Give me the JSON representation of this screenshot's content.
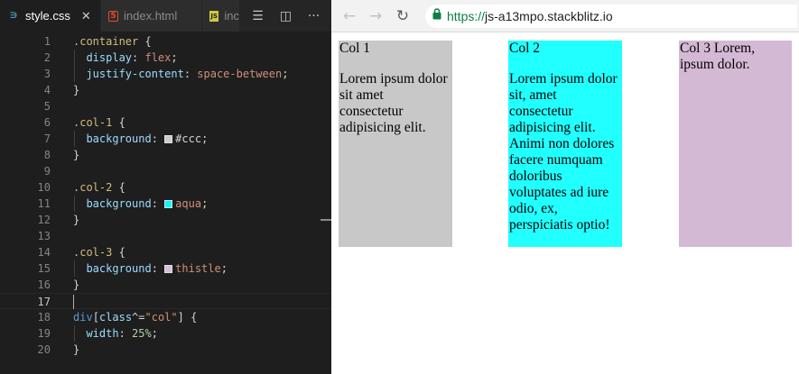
{
  "editor": {
    "tabs": [
      {
        "label": "style.css",
        "icon": "css-file-icon",
        "active": true,
        "close": "✕"
      },
      {
        "label": "index.html",
        "icon": "html-file-icon",
        "active": false
      },
      {
        "label": "inc",
        "icon": "js-file-icon",
        "active": false
      }
    ],
    "tab_icons": {
      "css": "∋",
      "html": "5",
      "js": "JS"
    },
    "actions": [
      {
        "name": "outline-icon",
        "glyph": "☰"
      },
      {
        "name": "split-editor-icon",
        "glyph": "◫"
      },
      {
        "name": "more-actions-icon",
        "glyph": "···"
      }
    ],
    "lines": [
      {
        "n": "1",
        "tokens": [
          {
            "t": ".container",
            "c": "sel"
          },
          {
            "t": " {",
            "c": "punc"
          }
        ]
      },
      {
        "n": "2",
        "indent": true,
        "tokens": [
          {
            "t": "  display",
            "c": "prop"
          },
          {
            "t": ": ",
            "c": "punc"
          },
          {
            "t": "flex",
            "c": "val"
          },
          {
            "t": ";",
            "c": "punc"
          }
        ]
      },
      {
        "n": "3",
        "indent": true,
        "tokens": [
          {
            "t": "  justify-content",
            "c": "prop"
          },
          {
            "t": ": ",
            "c": "punc"
          },
          {
            "t": "space-between",
            "c": "val"
          },
          {
            "t": ";",
            "c": "punc"
          }
        ]
      },
      {
        "n": "4",
        "tokens": [
          {
            "t": "}",
            "c": "punc"
          }
        ]
      },
      {
        "n": "5",
        "tokens": []
      },
      {
        "n": "6",
        "tokens": [
          {
            "t": ".col-1",
            "c": "sel"
          },
          {
            "t": " {",
            "c": "punc"
          }
        ]
      },
      {
        "n": "7",
        "indent": true,
        "tokens": [
          {
            "t": "  background",
            "c": "prop"
          },
          {
            "t": ": ",
            "c": "punc"
          },
          {
            "swatch": "#cccccc"
          },
          {
            "t": "#ccc",
            "c": "punc"
          },
          {
            "t": ";",
            "c": "punc"
          }
        ]
      },
      {
        "n": "8",
        "tokens": [
          {
            "t": "}",
            "c": "punc"
          }
        ]
      },
      {
        "n": "9",
        "tokens": []
      },
      {
        "n": "10",
        "tokens": [
          {
            "t": ".col-2",
            "c": "sel"
          },
          {
            "t": " {",
            "c": "punc"
          }
        ]
      },
      {
        "n": "11",
        "indent": true,
        "tokens": [
          {
            "t": "  background",
            "c": "prop"
          },
          {
            "t": ": ",
            "c": "punc"
          },
          {
            "swatch": "#00ffff"
          },
          {
            "t": "aqua",
            "c": "val"
          },
          {
            "t": ";",
            "c": "punc"
          }
        ]
      },
      {
        "n": "12",
        "tokens": [
          {
            "t": "}",
            "c": "punc"
          }
        ]
      },
      {
        "n": "13",
        "tokens": []
      },
      {
        "n": "14",
        "tokens": [
          {
            "t": ".col-3",
            "c": "sel"
          },
          {
            "t": " {",
            "c": "punc"
          }
        ]
      },
      {
        "n": "15",
        "indent": true,
        "tokens": [
          {
            "t": "  background",
            "c": "prop"
          },
          {
            "t": ": ",
            "c": "punc"
          },
          {
            "swatch": "#d8bfd8"
          },
          {
            "t": "thistle",
            "c": "val"
          },
          {
            "t": ";",
            "c": "punc"
          }
        ]
      },
      {
        "n": "16",
        "tokens": [
          {
            "t": "}",
            "c": "punc"
          }
        ]
      },
      {
        "n": "17",
        "current": true,
        "tokens": []
      },
      {
        "n": "18",
        "tokens": [
          {
            "t": "div",
            "c": "tagc"
          },
          {
            "t": "[",
            "c": "punc"
          },
          {
            "t": "class",
            "c": "prop"
          },
          {
            "t": "^=",
            "c": "punc"
          },
          {
            "t": "\"col\"",
            "c": "val"
          },
          {
            "t": "] {",
            "c": "punc"
          }
        ]
      },
      {
        "n": "19",
        "indent": true,
        "tokens": [
          {
            "t": "  width",
            "c": "prop"
          },
          {
            "t": ": ",
            "c": "punc"
          },
          {
            "t": "25%",
            "c": "num"
          },
          {
            "t": ";",
            "c": "punc"
          }
        ]
      },
      {
        "n": "20",
        "tokens": [
          {
            "t": "}",
            "c": "punc"
          }
        ]
      }
    ]
  },
  "browser": {
    "nav": {
      "back": "←",
      "forward": "→",
      "reload": "↻"
    },
    "url_scheme": "https://",
    "url_host": "js-a13mpo.stackblitz.io",
    "columns": [
      {
        "heading": "Col 1",
        "body": "Lorem ipsum dolor sit amet consectetur adipisicing elit.",
        "bg": "#c8c8c8"
      },
      {
        "heading": "Col 2",
        "body": "Lorem ipsum dolor sit, amet consectetur adipisicing elit. Animi non dolores facere numquam doloribus voluptates ad iure odio, ex, perspiciatis optio!",
        "bg": "#22ffff"
      },
      {
        "heading": "Col 3 Lorem, ipsum dolor.",
        "body": "",
        "bg": "#d4b9d4"
      }
    ]
  }
}
